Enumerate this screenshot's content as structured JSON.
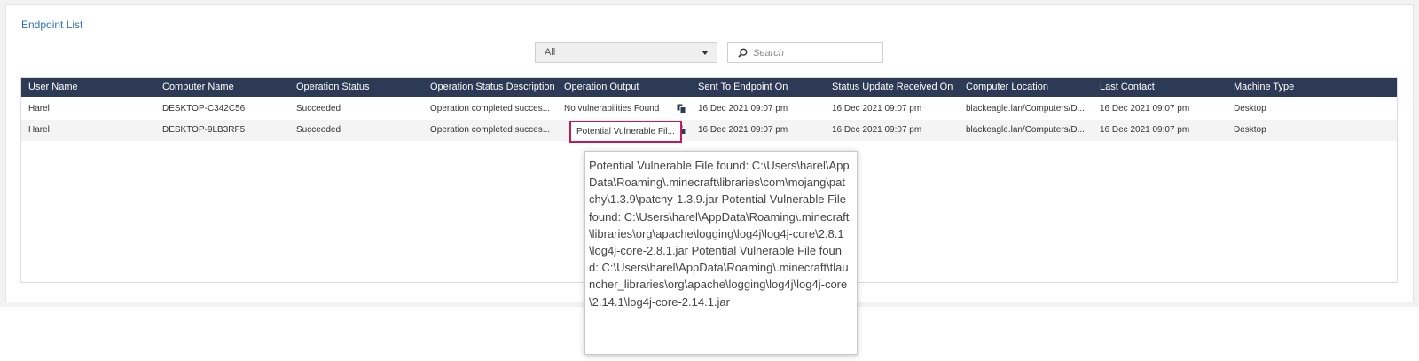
{
  "page": {
    "title": "Endpoint List"
  },
  "filter": {
    "selected": "All"
  },
  "search": {
    "placeholder": "Search"
  },
  "table": {
    "columns": [
      "User Name",
      "Computer Name",
      "Operation Status",
      "Operation Status Description",
      "Operation Output",
      "Sent To Endpoint On",
      "Status Update Received On",
      "Computer Location",
      "Last Contact",
      "Machine Type"
    ],
    "rows": [
      [
        "Harel",
        "DESKTOP-C342C56",
        "Succeeded",
        "Operation completed succes...",
        "No vulnerabilities Found",
        "16 Dec 2021 09:07 pm",
        "16 Dec 2021 09:07 pm",
        "blackeagle.lan/Computers/D...",
        "16 Dec 2021 09:07 pm",
        "Desktop"
      ],
      [
        "Harel",
        "DESKTOP-9LB3RF5",
        "Succeeded",
        "Operation completed succes...",
        "Potential Vulnerable Fil...",
        "16 Dec 2021 09:07 pm",
        "16 Dec 2021 09:07 pm",
        "blackeagle.lan/Computers/D...",
        "16 Dec 2021 09:07 pm",
        "Desktop"
      ]
    ]
  },
  "tooltip": {
    "text": "Potential Vulnerable File found: C:\\Users\\harel\\AppData\\Roaming\\.minecraft\\libraries\\com\\mojang\\patchy\\1.3.9\\patchy-1.3.9.jar Potential Vulnerable File found: C:\\Users\\harel\\AppData\\Roaming\\.minecraft\\libraries\\org\\apache\\logging\\log4j\\log4j-core\\2.8.1\\log4j-core-2.8.1.jar Potential Vulnerable File found: C:\\Users\\harel\\AppData\\Roaming\\.minecraft\\tlauncher_libraries\\org\\apache\\logging\\log4j\\log4j-core\\2.14.1\\log4j-core-2.14.1.jar"
  },
  "icons": {
    "search": "search-icon",
    "dropdown": "chevron-down-icon",
    "copy": "copy-icon"
  },
  "colors": {
    "header_bg": "#2d3a56",
    "title_link": "#2f72b8",
    "highlight_border": "#c41a5a"
  }
}
